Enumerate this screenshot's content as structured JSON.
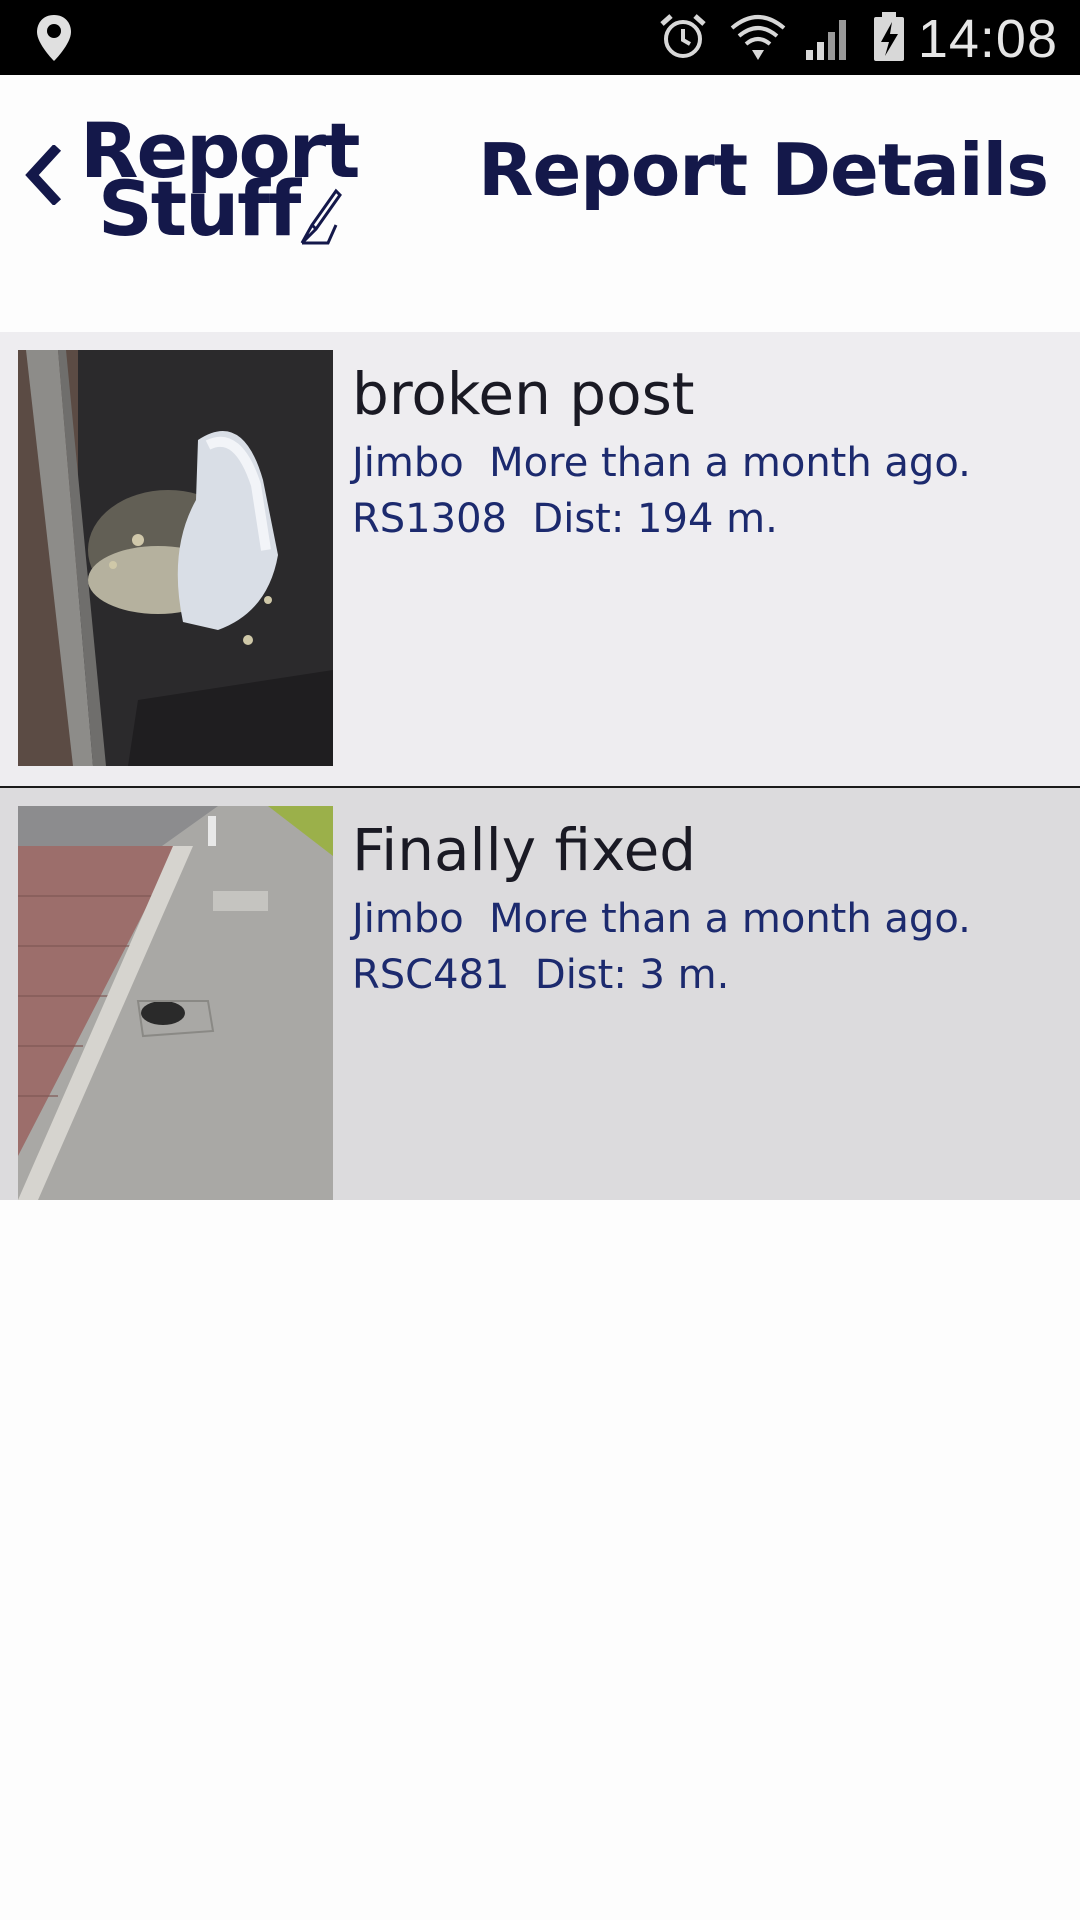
{
  "status_bar": {
    "time": "14:08",
    "icons": [
      "location-icon",
      "alarm-icon",
      "wifi-icon",
      "signal-icon",
      "battery-charging-icon"
    ]
  },
  "header": {
    "back_icon": "chevron-left-icon",
    "logo_line1": "Report",
    "logo_line2": "Stuff",
    "logo_icon": "pencil-note-icon",
    "title": "Report Details"
  },
  "colors": {
    "brand_navy": "#14184a",
    "meta_text": "#1c2a6e",
    "row1_bg": "#eeedf0",
    "row2_bg": "#dcdbdd"
  },
  "reports": [
    {
      "title": "broken post",
      "author_time": "Jimbo  More than a month ago.",
      "ref_dist": "RS1308  Dist: 194 m.",
      "image": "broken-post-photo"
    },
    {
      "title": "Finally fixed",
      "author_time": "Jimbo  More than a month ago.",
      "ref_dist": "RSC481  Dist: 3 m.",
      "image": "fixed-pavement-photo"
    }
  ]
}
